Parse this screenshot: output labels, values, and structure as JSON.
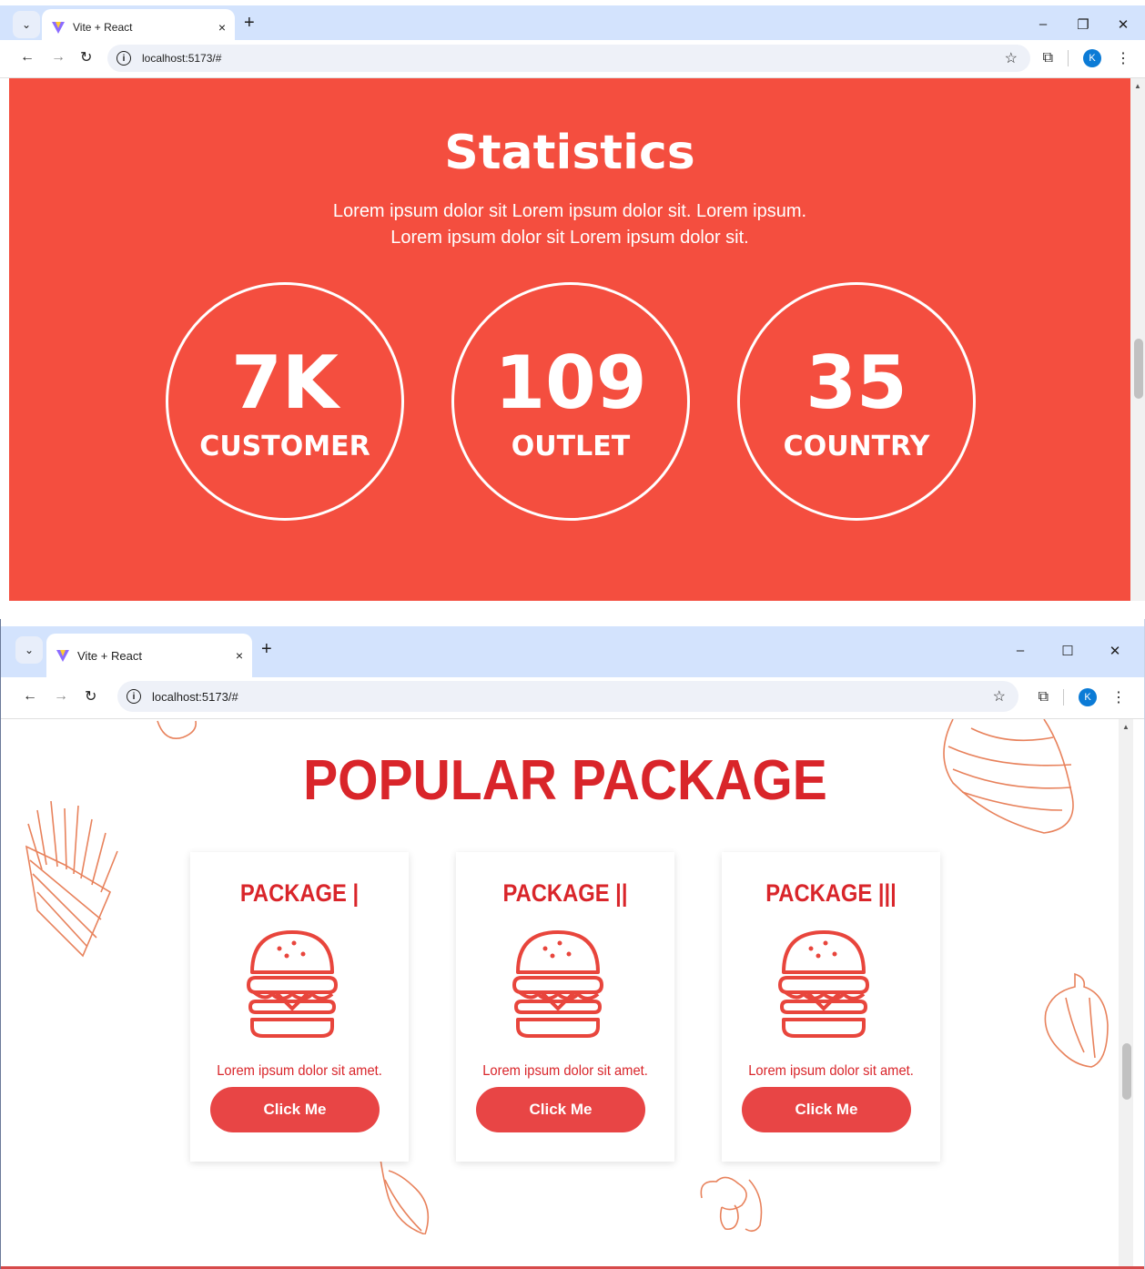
{
  "browser": {
    "tab_title": "Vite + React",
    "tab_close": "×",
    "new_tab": "+",
    "url": "localhost:5173/#",
    "avatar_letter": "K",
    "controls": {
      "minimize": "–",
      "restore": "❐",
      "maximize": "☐",
      "close": "✕"
    },
    "icons": [
      "chevron-down-icon",
      "vite-logo-icon",
      "back-icon",
      "forward-icon",
      "reload-icon",
      "info-icon",
      "star-icon",
      "extensions-icon",
      "menu-icon"
    ]
  },
  "statistics": {
    "title": "Statistics",
    "description_line1": "Lorem ipsum dolor sit Lorem ipsum dolor sit. Lorem ipsum.",
    "description_line2": "Lorem ipsum dolor sit Lorem ipsum dolor sit.",
    "items": [
      {
        "value": "7K",
        "label": "CUSTOMER"
      },
      {
        "value": "109",
        "label": "OUTLET"
      },
      {
        "value": "35",
        "label": "COUNTRY"
      }
    ],
    "background_color": "#f44e3f"
  },
  "popular": {
    "title": "POPULAR PACKAGE",
    "packages": [
      {
        "title": "PACKAGE |",
        "description": "Lorem ipsum dolor sit amet.",
        "button": "Click Me"
      },
      {
        "title": "PACKAGE ||",
        "description": "Lorem ipsum dolor sit amet.",
        "button": "Click Me"
      },
      {
        "title": "PACKAGE |||",
        "description": "Lorem ipsum dolor sit amet.",
        "button": "Click Me"
      }
    ],
    "accent_color": "#d9252a",
    "button_color": "#e84545"
  }
}
